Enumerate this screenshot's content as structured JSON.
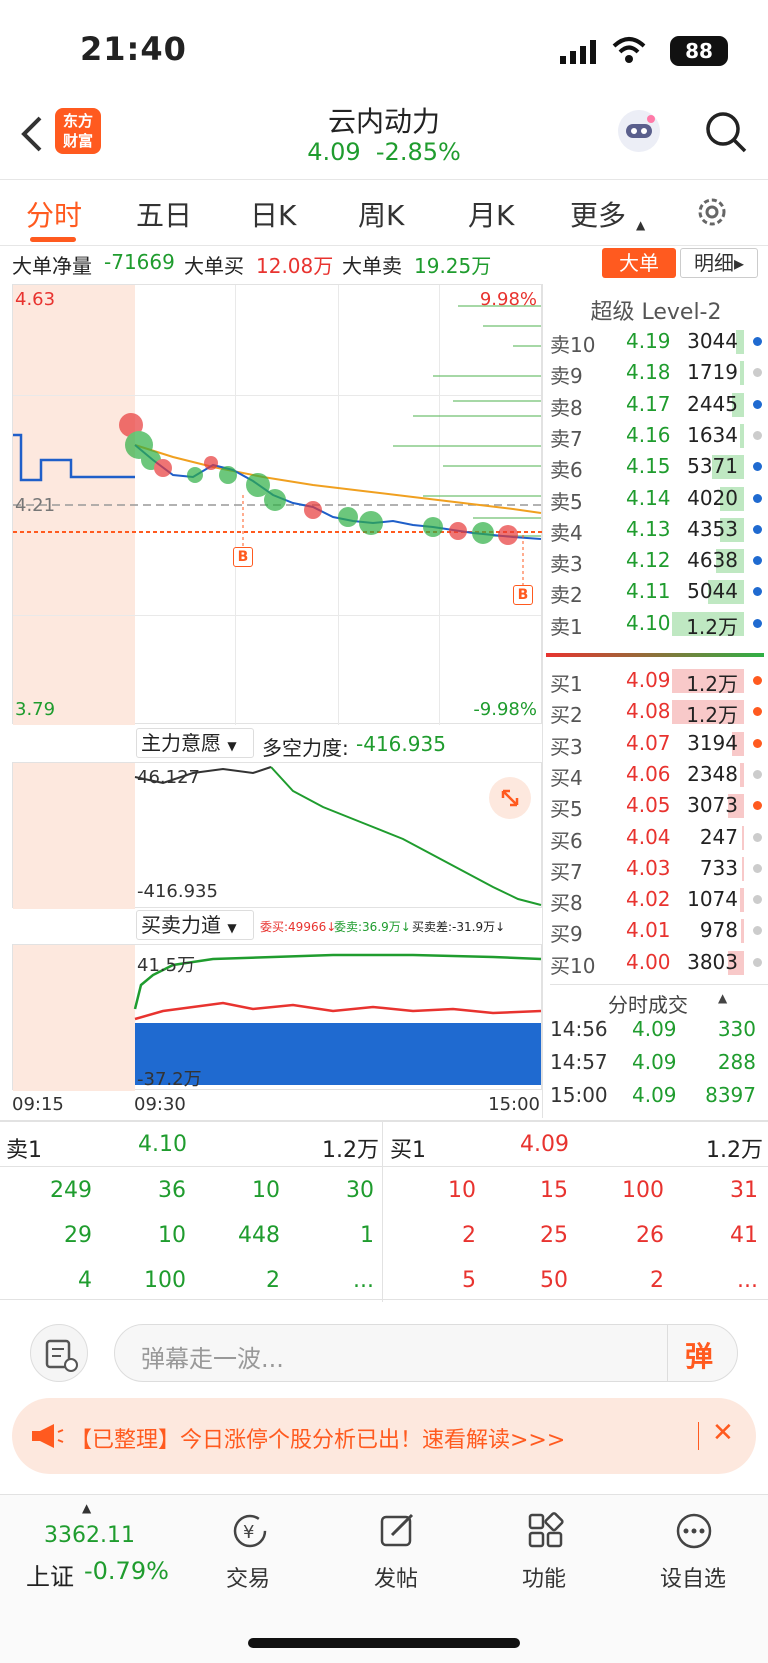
{
  "status": {
    "time": "21:40",
    "battery": "88"
  },
  "header": {
    "title": "云内动力",
    "price": "4.09",
    "change_pct": "-2.85%",
    "logo_line1": "东方",
    "logo_line2": "财富"
  },
  "tabs": [
    "分时",
    "五日",
    "日K",
    "周K",
    "月K",
    "更多"
  ],
  "bigorder": {
    "net_label": "大单净量",
    "net_value": "-71669",
    "buy_label": "大单买",
    "buy_value": "12.08万",
    "sell_label": "大单卖",
    "sell_value": "19.25万",
    "btn_big": "大单",
    "btn_detail": "明细"
  },
  "chart": {
    "y_high": "4.63",
    "y_low": "3.79",
    "y_mid": "4.21",
    "pct_high": "9.98%",
    "pct_low": "-9.98%",
    "marker": "B",
    "x_labels": [
      "09:15",
      "09:30",
      "15:00"
    ]
  },
  "chart_data": [
    {
      "type": "line",
      "title": "分时",
      "ylim": [
        3.79,
        4.63
      ],
      "y_ref": 4.21,
      "x": [
        "09:15",
        "09:30",
        "15:00"
      ],
      "series": [
        {
          "values": [
            4.25,
            4.26,
            4.24,
            4.22,
            4.2,
            4.18,
            4.15,
            4.13,
            4.12,
            4.11,
            4.1,
            4.09
          ]
        }
      ]
    },
    {
      "type": "line",
      "title": "主力意愿",
      "ylim": [
        -416.935,
        46.127
      ],
      "series": [
        {
          "values": [
            46.127,
            30,
            -20,
            -80,
            -140,
            -180,
            -220,
            -260,
            -300,
            -350,
            -390,
            -416.935
          ]
        }
      ]
    }
  ],
  "indicator1": {
    "name": "主力意愿",
    "label": "多空力度:",
    "value": "-416.935",
    "top": "46.127",
    "bottom": "-416.935"
  },
  "indicator2": {
    "name": "买卖力道",
    "wb_label": "委买:49966↓",
    "ws_label": "委卖:36.9万↓",
    "diff_label": "买卖差:-31.9万↓",
    "top": "41.5万",
    "bottom": "-37.2万"
  },
  "orderbook": {
    "title": "超级 Level-2",
    "asks": [
      {
        "label": "卖10",
        "price": "4.19",
        "vol": "3044"
      },
      {
        "label": "卖9",
        "price": "4.18",
        "vol": "1719"
      },
      {
        "label": "卖8",
        "price": "4.17",
        "vol": "2445"
      },
      {
        "label": "卖7",
        "price": "4.16",
        "vol": "1634"
      },
      {
        "label": "卖6",
        "price": "4.15",
        "vol": "5371"
      },
      {
        "label": "卖5",
        "price": "4.14",
        "vol": "4020"
      },
      {
        "label": "卖4",
        "price": "4.13",
        "vol": "4353"
      },
      {
        "label": "卖3",
        "price": "4.12",
        "vol": "4638"
      },
      {
        "label": "卖2",
        "price": "4.11",
        "vol": "5044"
      },
      {
        "label": "卖1",
        "price": "4.10",
        "vol": "1.2万"
      }
    ],
    "bids": [
      {
        "label": "买1",
        "price": "4.09",
        "vol": "1.2万"
      },
      {
        "label": "买2",
        "price": "4.08",
        "vol": "1.2万"
      },
      {
        "label": "买3",
        "price": "4.07",
        "vol": "3194"
      },
      {
        "label": "买4",
        "price": "4.06",
        "vol": "2348"
      },
      {
        "label": "买5",
        "price": "4.05",
        "vol": "3073"
      },
      {
        "label": "买6",
        "price": "4.04",
        "vol": "247"
      },
      {
        "label": "买7",
        "price": "4.03",
        "vol": "733"
      },
      {
        "label": "买8",
        "price": "4.02",
        "vol": "1074"
      },
      {
        "label": "买9",
        "price": "4.01",
        "vol": "978"
      },
      {
        "label": "买10",
        "price": "4.00",
        "vol": "3803"
      }
    ],
    "trades_title": "分时成交",
    "trades": [
      {
        "time": "14:56",
        "price": "4.09",
        "vol": "330"
      },
      {
        "time": "14:57",
        "price": "4.09",
        "vol": "288"
      },
      {
        "time": "15:00",
        "price": "4.09",
        "vol": "8397"
      }
    ]
  },
  "queue": {
    "sell_label": "卖1",
    "sell_price": "4.10",
    "sell_vol": "1.2万",
    "buy_label": "买1",
    "buy_price": "4.09",
    "buy_vol": "1.2万",
    "sell_rows": [
      [
        "249",
        "36",
        "10",
        "30"
      ],
      [
        "29",
        "10",
        "448",
        "1"
      ],
      [
        "4",
        "100",
        "2",
        "..."
      ]
    ],
    "buy_rows": [
      [
        "10",
        "15",
        "100",
        "31"
      ],
      [
        "2",
        "25",
        "26",
        "41"
      ],
      [
        "5",
        "50",
        "2",
        "..."
      ]
    ]
  },
  "danmaku": {
    "placeholder": "弹幕走一波...",
    "send": "弹"
  },
  "banner": {
    "text": "【已整理】今日涨停个股分析已出！速看解读>>>"
  },
  "bottomnav": {
    "index_value": "3362.11",
    "index_name": "上证",
    "index_change": "-0.79%",
    "items": [
      "交易",
      "发帖",
      "功能",
      "设自选"
    ]
  }
}
